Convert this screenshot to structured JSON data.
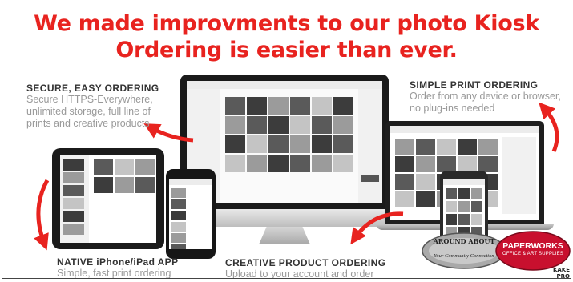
{
  "headline": {
    "line1": "We made improvments to our photo Kiosk",
    "line2": "Ordering is easier than ever."
  },
  "features": {
    "secure": {
      "title": "SECURE, EASY ORDERING",
      "desc": "Secure HTTPS-Everywhere, unlimited storage, full line of prints and creative products"
    },
    "simple": {
      "title": "SIMPLE PRINT ORDERING",
      "desc": "Order from any device or browser, no plug-ins needed"
    },
    "native": {
      "title": "NATIVE iPhone/iPad APP",
      "desc": "Simple, fast print ordering"
    },
    "creative": {
      "title": "CREATIVE PRODUCT ORDERING",
      "desc": "Upload to your account and order"
    }
  },
  "logos": {
    "around": {
      "name": "AROUND ABOUT",
      "tagline": "Your Community Connection"
    },
    "paperworks": {
      "name": "PAPERWORKS",
      "tagline": "OFFICE & ART SUPPLIES",
      "partner": "KAKE PRO"
    }
  },
  "colors": {
    "accent": "#e8231f",
    "title_text": "#333333",
    "desc_text": "#999999",
    "paperworks": "#c8102e"
  },
  "icons": {
    "arrows": "curved-arrow-icon"
  }
}
